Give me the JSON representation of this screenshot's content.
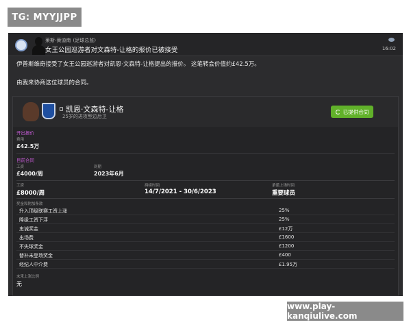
{
  "watermark_top": "TG: MYYJJPP",
  "watermark_bottom": "www.play-kanqiulive.com",
  "message": {
    "sender_name": "莱斯-黄迪南",
    "sender_role": "(足球总监)",
    "subject": "女王公园巡游者对文森特-让格的报价已被接受",
    "time": "16:02",
    "body_line1": "伊普斯维奇接受了女王公园巡游者对凯恩·文森特-让格提出的报价。 这笔转会价值约£42.5万。",
    "body_line2": "由我来协商这位球员的合同。"
  },
  "player": {
    "name": "凯恩·文森特-让格",
    "description": "25岁的进攻型边后卫",
    "offer_button": "已提供合同"
  },
  "transfer_offer": {
    "section_title": "开出报价",
    "fee_label": "费用",
    "fee_value": "£42.5万"
  },
  "current_contract": {
    "section_title": "目前合同",
    "wage_label": "工资",
    "wage_value": "£4000/周",
    "expiry_label": "到期",
    "expiry_value": "2023年6月"
  },
  "new_contract": {
    "wage_label": "工资",
    "wage_value": "£8000/周",
    "duration_label": "持续时间",
    "duration_value": "14/7/2021 - 30/6/2023",
    "role_label": "承诺上场时间",
    "role_value": "重要球员"
  },
  "clauses": {
    "title": "奖金和附加条款",
    "rows": [
      {
        "name": "升入顶级联赛工资上涨",
        "value": "25%"
      },
      {
        "name": "降级工资下浮",
        "value": "25%"
      },
      {
        "name": "忠诚奖金",
        "value": "£12万"
      },
      {
        "name": "出场费",
        "value": "£1600"
      },
      {
        "name": "不失球奖金",
        "value": "£1200"
      },
      {
        "name": "替补未登场奖金",
        "value": "£400"
      },
      {
        "name": "经纪人中介费",
        "value": "£1.95万"
      }
    ]
  },
  "release_clause": {
    "label": "未来上涨比例",
    "value": "无"
  },
  "colors": {
    "background": "#2c2c2e",
    "section_accent": "#c05ad0",
    "button_green": "#61b12a"
  }
}
